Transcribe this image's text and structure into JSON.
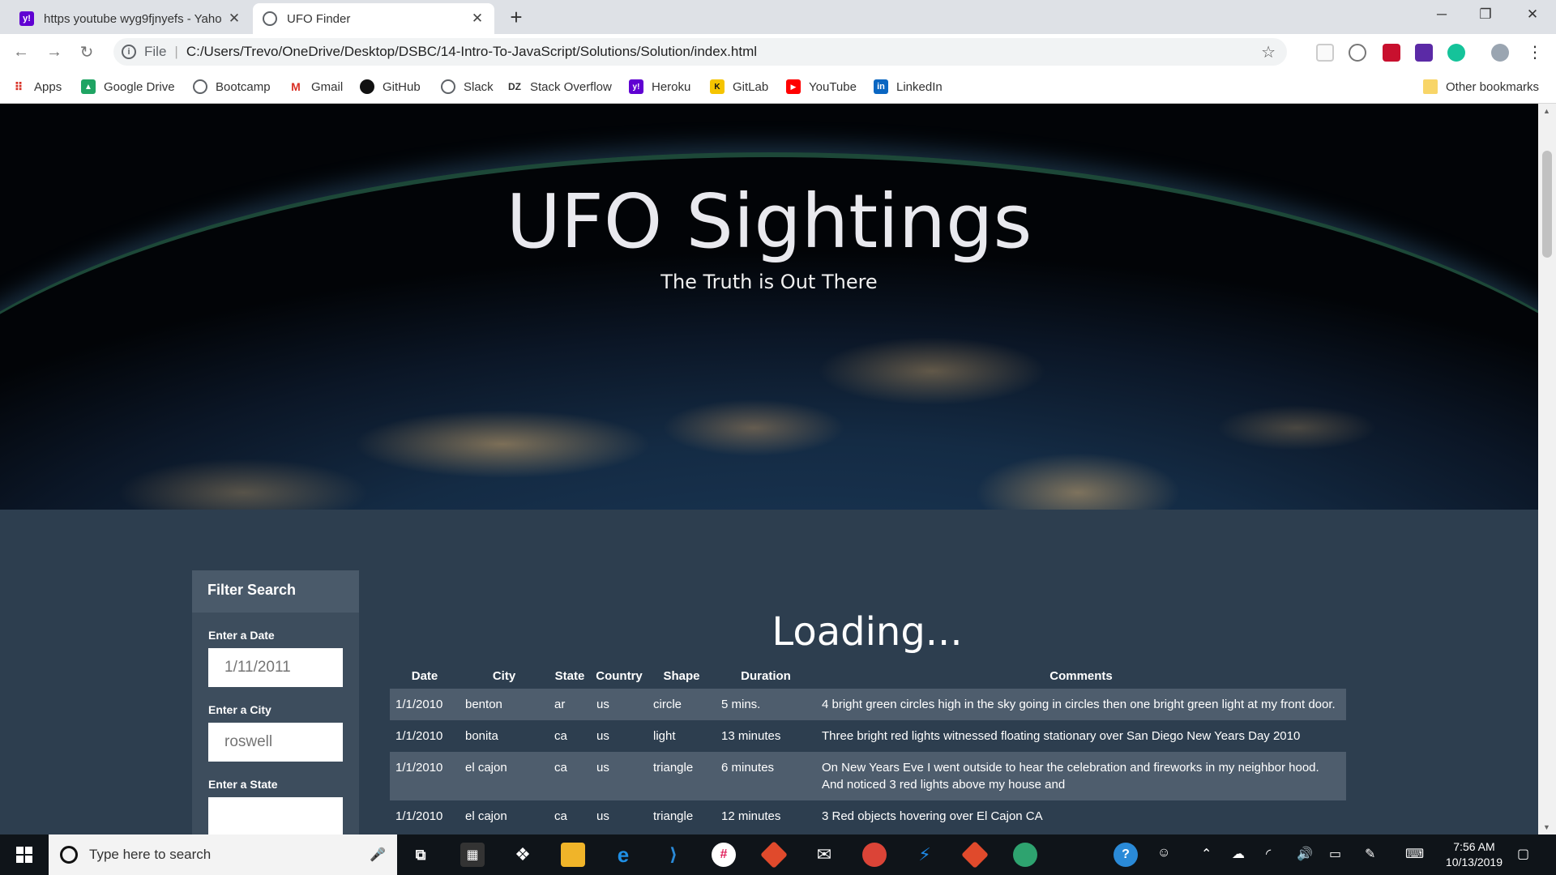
{
  "browser": {
    "tabs": [
      {
        "title": "https youtube wyg9fjnyefs - Yaho",
        "favicon": "yahoo-icon"
      },
      {
        "title": "UFO Finder",
        "favicon": "globe-icon"
      }
    ],
    "address": {
      "scheme": "File",
      "url": "C:/Users/Trevo/OneDrive/Desktop/DSBC/14-Intro-To-JavaScript/Solutions/Solution/index.html"
    },
    "bookmarks": [
      "Apps",
      "Google Drive",
      "Bootcamp",
      "Gmail",
      "GitHub",
      "Slack",
      "Stack Overflow",
      "Heroku",
      "GitLab",
      "YouTube",
      "LinkedIn"
    ],
    "other_bookmarks": "Other bookmarks"
  },
  "hero": {
    "title": "UFO Sightings",
    "subtitle": "The Truth is Out There"
  },
  "filter": {
    "heading": "Filter Search",
    "date_label": "Enter a Date",
    "date_value": "1/11/2011",
    "city_label": "Enter a City",
    "city_value": "roswell",
    "state_label": "Enter a State"
  },
  "loading": "Loading...",
  "table": {
    "headers": [
      "Date",
      "City",
      "State",
      "Country",
      "Shape",
      "Duration",
      "Comments"
    ],
    "rows": [
      [
        "1/1/2010",
        "benton",
        "ar",
        "us",
        "circle",
        "5 mins.",
        "4 bright green circles high in the sky going in circles then one bright green light at my front door."
      ],
      [
        "1/1/2010",
        "bonita",
        "ca",
        "us",
        "light",
        "13 minutes",
        "Three bright red lights witnessed floating stationary over San Diego New Years Day 2010"
      ],
      [
        "1/1/2010",
        "el cajon",
        "ca",
        "us",
        "triangle",
        "6 minutes",
        "On New Years Eve I went outside to hear the celebration and fireworks in my neighbor hood. And noticed 3 red lights above my house and"
      ],
      [
        "1/1/2010",
        "el cajon",
        "ca",
        "us",
        "triangle",
        "12 minutes",
        "3 Red objects hovering over El Cajon CA"
      ]
    ]
  },
  "taskbar": {
    "search_placeholder": "Type here to search",
    "time": "7:56 AM",
    "date": "10/13/2019"
  }
}
